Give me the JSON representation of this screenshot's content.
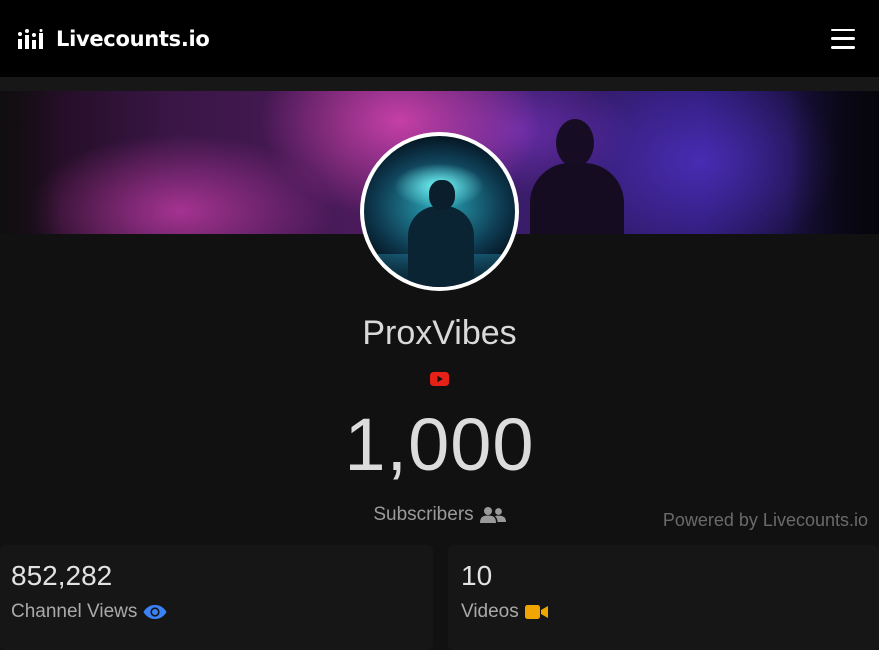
{
  "navbar": {
    "brand_name": "Livecounts.io",
    "brand_icon": "bar-chart-icon",
    "menu_icon": "hamburger-menu-icon"
  },
  "channel": {
    "name": "ProxVibes",
    "platform_icon": "youtube-icon",
    "subscriber_count": "1,000",
    "subscriber_label": "Subscribers"
  },
  "footer": {
    "powered_by": "Powered by Livecounts.io"
  },
  "stats": [
    {
      "value": "852,282",
      "label": "Channel Views",
      "icon": "eye-icon",
      "icon_color": "#3b82f6"
    },
    {
      "value": "10",
      "label": "Videos",
      "icon": "video-camera-icon",
      "icon_color": "#f0a500"
    }
  ],
  "colors": {
    "background": "#111111",
    "navbar": "#000000",
    "youtube_red": "#e62117"
  }
}
